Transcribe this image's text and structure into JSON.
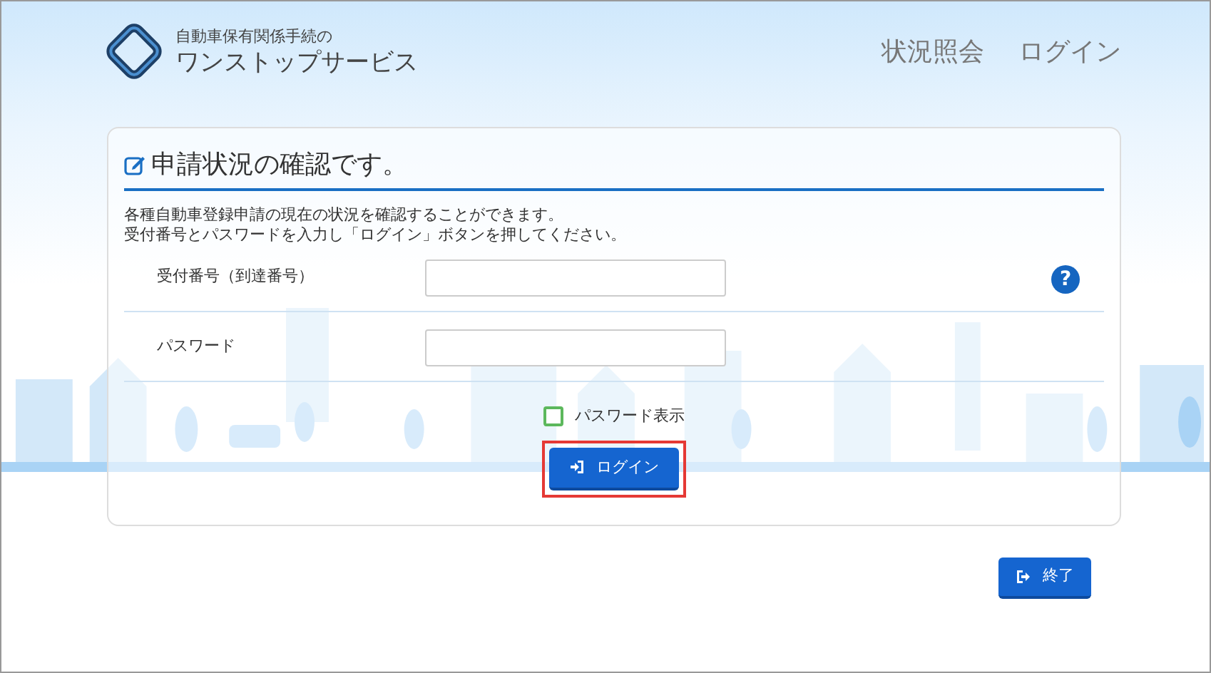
{
  "header": {
    "logo_line1": "自動車保有関係手続の",
    "logo_line2": "ワンストップサービス",
    "nav": [
      {
        "label": "状況照会"
      },
      {
        "label": "ログイン"
      }
    ]
  },
  "panel": {
    "title": "申請状況の確認です。",
    "description": [
      "各種自動車登録申請の現在の状況を確認することができます。",
      "受付番号とパスワードを入力し「ログイン」ボタンを押してください。"
    ],
    "fields": [
      {
        "label": "受付番号（到達番号）",
        "help": "?"
      },
      {
        "label": "パスワード"
      }
    ],
    "show_password": {
      "label": "パスワード表示",
      "checked": false
    },
    "login_button": {
      "label": "ログイン",
      "highlighted": true
    }
  },
  "end_button": {
    "label": "終了"
  }
}
